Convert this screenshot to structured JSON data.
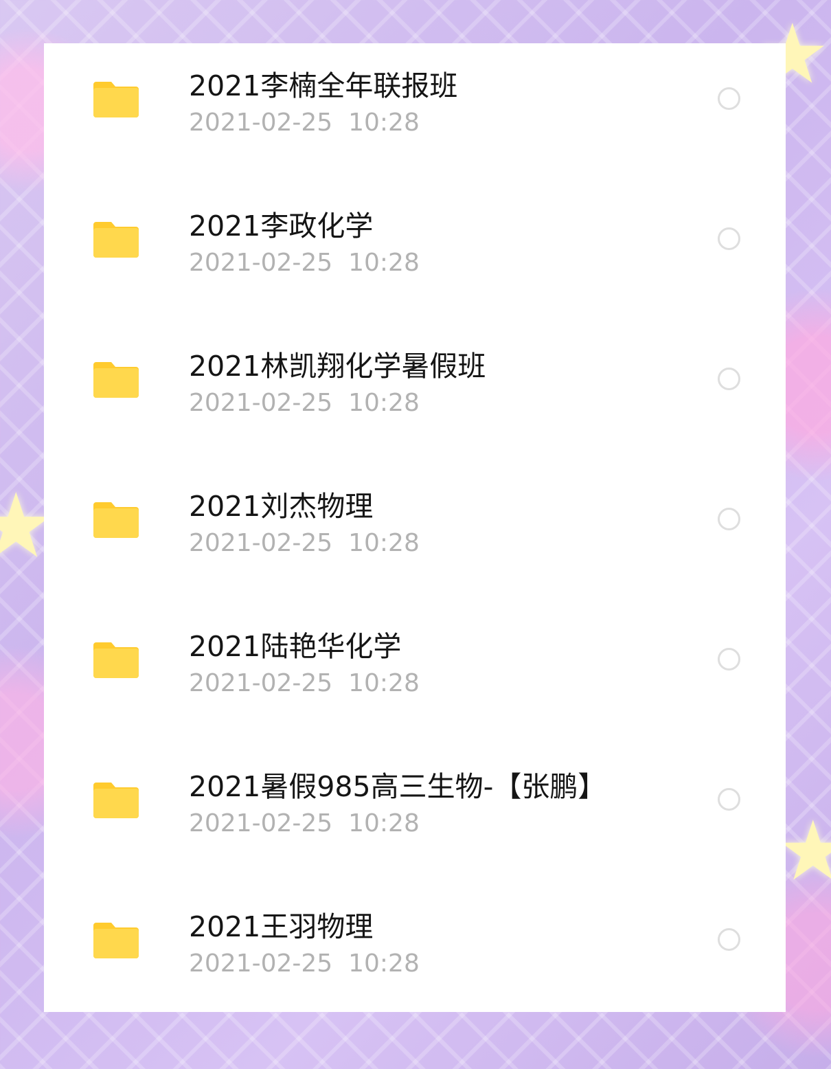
{
  "files": [
    {
      "name": "2021李楠全年联报班",
      "date": "2021-02-25  10:28",
      "icon": "folder-icon",
      "selected": false
    },
    {
      "name": "2021李政化学",
      "date": "2021-02-25  10:28",
      "icon": "folder-icon",
      "selected": false
    },
    {
      "name": "2021林凯翔化学暑假班",
      "date": "2021-02-25  10:28",
      "icon": "folder-icon",
      "selected": false
    },
    {
      "name": "2021刘杰物理",
      "date": "2021-02-25  10:28",
      "icon": "folder-icon",
      "selected": false
    },
    {
      "name": "2021陆艳华化学",
      "date": "2021-02-25  10:28",
      "icon": "folder-icon",
      "selected": false
    },
    {
      "name": "2021暑假985高三生物-【张鹏】",
      "date": "2021-02-25  10:28",
      "icon": "folder-icon",
      "selected": false
    },
    {
      "name": "2021王羽物理",
      "date": "2021-02-25  10:28",
      "icon": "folder-icon",
      "selected": false
    }
  ],
  "colors": {
    "folder": "#FFD84D",
    "folder_tab": "#FFCB2E",
    "name_text": "#151515",
    "date_text": "#B2B2B2",
    "radio_border": "#DEDEDE"
  }
}
